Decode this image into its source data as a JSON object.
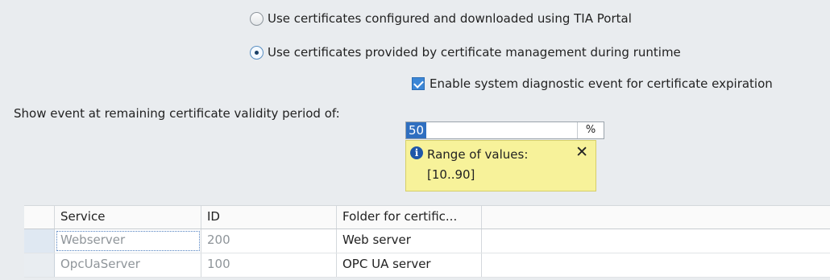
{
  "certificate_options": {
    "radio_tia": {
      "label": "Use certificates configured and downloaded using TIA Portal",
      "selected": false
    },
    "radio_runtime": {
      "label": "Use certificates provided by certificate management during runtime",
      "selected": true
    },
    "checkbox_expiration": {
      "label": "Enable system diagnostic event for certificate expiration",
      "checked": true
    }
  },
  "validity": {
    "label": "Show event at remaining certificate validity period of:",
    "value": "50",
    "unit": "%",
    "tooltip": {
      "icon": "info-icon",
      "text": "Range of values:\n[10..90]",
      "close": "✕"
    }
  },
  "table": {
    "columns": [
      "Service",
      "ID",
      "Folder for certific..."
    ],
    "rows": [
      {
        "service": "Webserver",
        "id": "200",
        "folder": "Web server"
      },
      {
        "service": "OpcUaServer",
        "id": "100",
        "folder": "OPC UA server"
      }
    ]
  }
}
